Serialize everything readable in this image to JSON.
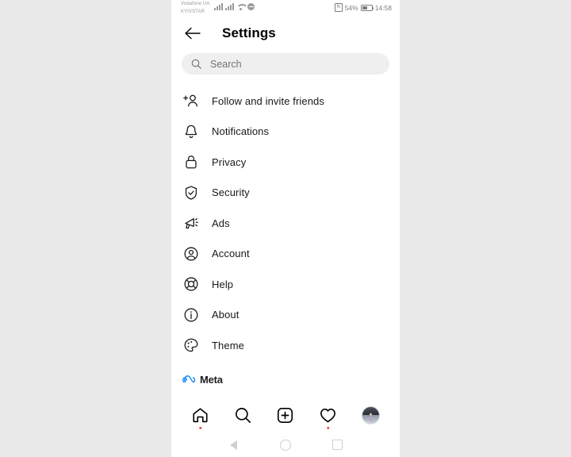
{
  "status_bar": {
    "carrier_line1": "Vodafone UA",
    "carrier_line2": "KYIVSTAR",
    "nfc_glyph": "N",
    "battery_percent": "54%",
    "time": "14:58",
    "icons": [
      "signal-bars-icon",
      "signal-bars-icon",
      "wifi-icon",
      "do-not-disturb-icon",
      "nfc-icon",
      "battery-icon"
    ]
  },
  "header": {
    "back_icon": "arrow-left-icon",
    "title": "Settings"
  },
  "search": {
    "icon": "search-icon",
    "placeholder": "Search",
    "value": ""
  },
  "menu": {
    "items": [
      {
        "label": "Follow and invite friends",
        "icon": "person-add-icon"
      },
      {
        "label": "Notifications",
        "icon": "bell-icon"
      },
      {
        "label": "Privacy",
        "icon": "lock-icon"
      },
      {
        "label": "Security",
        "icon": "shield-check-icon"
      },
      {
        "label": "Ads",
        "icon": "megaphone-icon"
      },
      {
        "label": "Account",
        "icon": "person-circle-icon"
      },
      {
        "label": "Help",
        "icon": "life-ring-icon"
      },
      {
        "label": "About",
        "icon": "info-circle-icon"
      },
      {
        "label": "Theme",
        "icon": "palette-icon"
      }
    ]
  },
  "branding": {
    "logo_icon": "meta-infinity-icon",
    "label": "Meta",
    "color": "#0082FB"
  },
  "bottom_nav": {
    "items": [
      {
        "name": "home",
        "icon": "home-icon",
        "badge": true
      },
      {
        "name": "search",
        "icon": "search-icon",
        "badge": false
      },
      {
        "name": "create",
        "icon": "plus-square-icon",
        "badge": false
      },
      {
        "name": "activity",
        "icon": "heart-icon",
        "badge": true
      },
      {
        "name": "profile",
        "icon": "avatar-icon",
        "badge": false
      }
    ],
    "badge_color": "#ED4956"
  },
  "android_nav": {
    "items": [
      {
        "name": "back",
        "icon": "triangle-back-icon"
      },
      {
        "name": "home",
        "icon": "circle-home-icon"
      },
      {
        "name": "recents",
        "icon": "square-recents-icon"
      }
    ]
  }
}
